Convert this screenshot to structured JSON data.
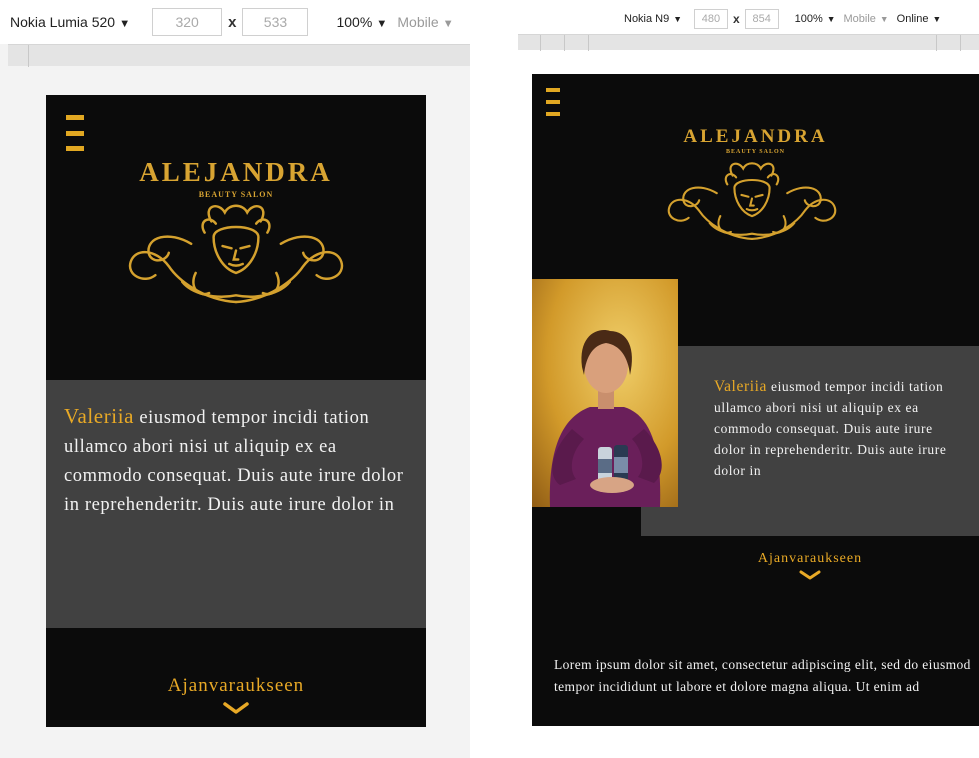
{
  "colors": {
    "gold": "#e8a926",
    "panel": "#414141",
    "page_bg": "#0b0b0b",
    "text": "#f2f2f2"
  },
  "left_device": {
    "device_label": "Nokia Lumia 520",
    "width_value": "320",
    "height_value": "533",
    "separator": "x",
    "zoom_label": "100%",
    "mode_label": "Mobile"
  },
  "right_device": {
    "device_label": "Nokia N9",
    "width_value": "480",
    "height_value": "854",
    "separator": "x",
    "zoom_label": "100%",
    "mode_label": "Mobile",
    "network_label": "Online"
  },
  "site": {
    "brand_name": "ALEJANDRA",
    "brand_subtitle": "BEAUTY SALON",
    "emblem_icon": "ornamental-face-emblem",
    "menu_icon": "hamburger-menu-icon",
    "bio_name": "Valeriia",
    "bio_text": " eiusmod tempor incidi tation ullamco abori nisi ut aliquip ex ea commodo consequat. Duis aute irure dolor in reprehenderitr. Duis aute irure dolor in",
    "cta_label": "Ajanvaraukseen",
    "cta_icon": "chevron-down-icon",
    "intro_text": "Lorem ipsum dolor sit amet, consectetur adipiscing elit, sed do eiusmod tempor incididunt ut labore et dolore magna aliqua. Ut enim ad"
  }
}
